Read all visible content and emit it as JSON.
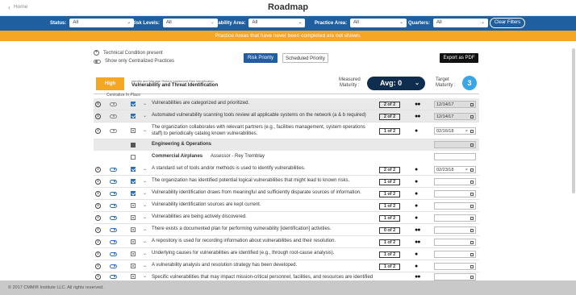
{
  "header": {
    "back_label": "Home",
    "title": "Roadmap"
  },
  "filters": [
    {
      "label": "Status:",
      "value": "All"
    },
    {
      "label": "Risk Levels:",
      "value": "All"
    },
    {
      "label": "Capability Area:",
      "value": "All"
    },
    {
      "label": "Practice Area:",
      "value": "All"
    },
    {
      "label": "Quarters:",
      "value": "All"
    }
  ],
  "clear_label": "Clear Filters",
  "banner": "Practice Areas that have never been completed are not shown.",
  "options": {
    "technical": "Technical Condition present",
    "centralized": "Show only Centralized Practices"
  },
  "buttons": {
    "risk": "Risk Priority",
    "scheduled": "Scheduled Priority",
    "export": "Export as PDF"
  },
  "group": {
    "level": "High",
    "subtitle": "Identify and Manage Risks ▸ Implement Risk Identification",
    "title": "Vulnerability and Threat Identification",
    "measured_label": "Measured\nMaturity :",
    "avg": "Avg: 0",
    "target_label": "Target\nMaturity :",
    "target": "3"
  },
  "columns": {
    "centralize": "Centralize",
    "in_place": "In Place"
  },
  "rows": [
    {
      "text": "Vulnerabilities are categorized and prioritized.",
      "level": "2 of 2",
      "dots": "●●",
      "date": "12/14/17",
      "shaded": true,
      "eye": "off",
      "chk": "on"
    },
    {
      "text": "Automated vulnerability scanning tools review all applicable systems on the network (a & b required)",
      "level": "2 of 2",
      "dots": "●●",
      "date": "12/14/17",
      "shaded": true,
      "eye": "off",
      "chk": "on"
    },
    {
      "text": "The organization collaborates with relevant partners (e.g., facilities management, system operations staff) to periodically catalog known vulnerabilities.",
      "level": "1 of 2",
      "dots": "●",
      "date": "02/16/18",
      "shaded": false,
      "eye": "off",
      "chk": "half"
    },
    {
      "text": "A standard set of tools and/or methods is used to identify vulnerabilities.",
      "level": "2 of 2",
      "dots": "●",
      "date": "02/23/18",
      "shaded": false,
      "eye": "on",
      "chk": "on"
    },
    {
      "text": "The organization has identified potential logical vulnerabilities that might lead to known risks.",
      "level": "1 of 2",
      "dots": "●",
      "date": "",
      "shaded": false,
      "eye": "on",
      "chk": "on"
    },
    {
      "text": "Vulnerability identification draws from meaningful and sufficiently disparate sources of information.",
      "level": "1 of 2",
      "dots": "●",
      "date": "",
      "shaded": false,
      "eye": "on",
      "chk": "on"
    },
    {
      "text": "Vulnerability identification sources are kept current.",
      "level": "1 of 2",
      "dots": "●",
      "date": "",
      "shaded": false,
      "eye": "on",
      "chk": "half"
    },
    {
      "text": "Vulnerabilities are being actively discovered.",
      "level": "1 of 2",
      "dots": "●",
      "date": "",
      "shaded": false,
      "eye": "on",
      "chk": "half"
    },
    {
      "text": "There exists a documented plan for performing vulnerability [identification] activities.",
      "level": "0 of 2",
      "dots": "●●",
      "date": "",
      "shaded": false,
      "eye": "on",
      "chk": "half"
    },
    {
      "text": "A repository is used for recording information about vulnerabilities and their resolution.",
      "level": "1 of 2",
      "dots": "●●",
      "date": "",
      "shaded": false,
      "eye": "on",
      "chk": "half"
    },
    {
      "text": "Underlying causes for vulnerabilities are identified (e.g., through root-cause analysis).",
      "level": "1 of 2",
      "dots": "●",
      "date": "",
      "shaded": false,
      "eye": "on",
      "chk": "half"
    },
    {
      "text": "A vulnerability analysis and resolution strategy has been developed.",
      "level": "1 of 2",
      "dots": "●",
      "date": "",
      "shaded": false,
      "eye": "on",
      "chk": "half"
    },
    {
      "text": "Specific vulnerabilities that may impact mission-critical personnel, facilities, and resources are identified",
      "level": "",
      "dots": "●●",
      "date": "",
      "shaded": false,
      "eye": "on",
      "chk": "half"
    }
  ],
  "subsection": {
    "title": "Engineering & Operations",
    "company": "Commercial Airplanes",
    "assessor": "Assessor - Rey Tremblay"
  },
  "footer": "© 2017 CMMI® Institute LLC. All rights reserved.",
  "colors": {
    "nav": "#1f5fa0",
    "banner": "#f5a623",
    "avg": "#0f2d4f",
    "target": "#3aa6e8"
  }
}
